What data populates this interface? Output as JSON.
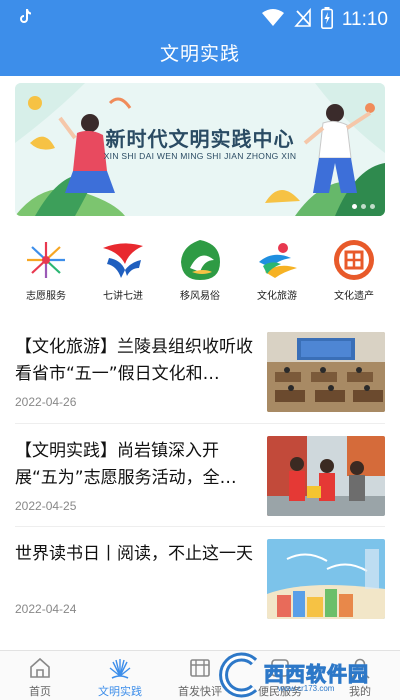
{
  "status_bar": {
    "time": "11:10",
    "icons": [
      "tiktok-icon",
      "wifi-icon",
      "no-signal-icon",
      "battery-charging-icon"
    ]
  },
  "header": {
    "title": "文明实践"
  },
  "banner": {
    "title": "新时代文明实践中心",
    "subtitle": "XIN SHI DAI WEN MING SHI JIAN ZHONG XIN",
    "slides": 3,
    "active_slide": 1
  },
  "categories": [
    {
      "label": "志愿服务",
      "icon": "volunteer-service-icon"
    },
    {
      "label": "七讲七进",
      "icon": "seven-lectures-icon"
    },
    {
      "label": "移风易俗",
      "icon": "customs-reform-icon"
    },
    {
      "label": "文化旅游",
      "icon": "culture-tourism-icon"
    },
    {
      "label": "文化遗产",
      "icon": "cultural-heritage-icon"
    }
  ],
  "news": [
    {
      "title": "【文化旅游】兰陵县组织收听收看省市“五一”假日文化和…",
      "date": "2022-04-26"
    },
    {
      "title": "【文明实践】尚岩镇深入开展“五为”志愿服务活动，全…",
      "date": "2022-04-25"
    },
    {
      "title": "世界读书日丨阅读，不止这一天",
      "date": "2022-04-24"
    }
  ],
  "bottom_nav": [
    {
      "label": "首页",
      "icon": "home-icon",
      "active": false
    },
    {
      "label": "文明实践",
      "icon": "civilization-practice-icon",
      "active": true
    },
    {
      "label": "首发快评",
      "icon": "film-icon",
      "active": false
    },
    {
      "label": "便民服务",
      "icon": "service-icon",
      "active": false
    },
    {
      "label": "我的",
      "icon": "profile-icon",
      "active": false
    }
  ],
  "watermark": {
    "text": "西西软件园",
    "url": "www.cr173.com"
  },
  "colors": {
    "primary": "#3d8eea",
    "text": "#111111",
    "date": "#888888"
  }
}
